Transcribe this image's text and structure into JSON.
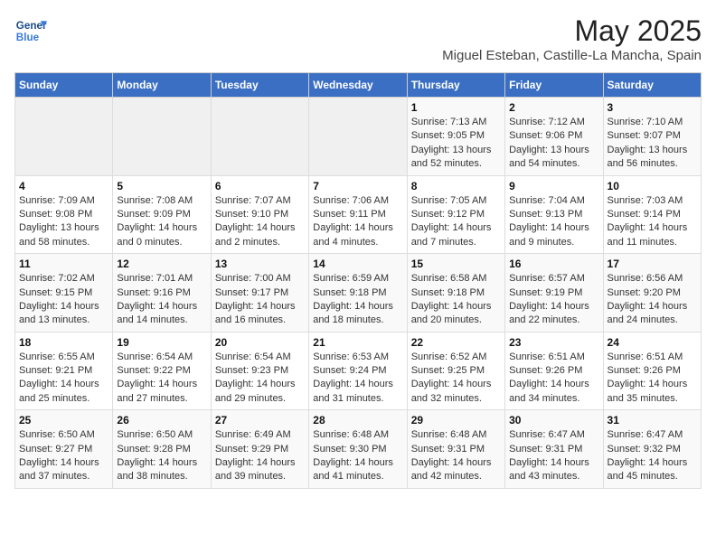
{
  "logo": {
    "line1": "General",
    "line2": "Blue"
  },
  "title": "May 2025",
  "subtitle": "Miguel Esteban, Castille-La Mancha, Spain",
  "headers": [
    "Sunday",
    "Monday",
    "Tuesday",
    "Wednesday",
    "Thursday",
    "Friday",
    "Saturday"
  ],
  "weeks": [
    [
      {
        "day": "",
        "info": ""
      },
      {
        "day": "",
        "info": ""
      },
      {
        "day": "",
        "info": ""
      },
      {
        "day": "",
        "info": ""
      },
      {
        "day": "1",
        "info": "Sunrise: 7:13 AM\nSunset: 9:05 PM\nDaylight: 13 hours\nand 52 minutes."
      },
      {
        "day": "2",
        "info": "Sunrise: 7:12 AM\nSunset: 9:06 PM\nDaylight: 13 hours\nand 54 minutes."
      },
      {
        "day": "3",
        "info": "Sunrise: 7:10 AM\nSunset: 9:07 PM\nDaylight: 13 hours\nand 56 minutes."
      }
    ],
    [
      {
        "day": "4",
        "info": "Sunrise: 7:09 AM\nSunset: 9:08 PM\nDaylight: 13 hours\nand 58 minutes."
      },
      {
        "day": "5",
        "info": "Sunrise: 7:08 AM\nSunset: 9:09 PM\nDaylight: 14 hours\nand 0 minutes."
      },
      {
        "day": "6",
        "info": "Sunrise: 7:07 AM\nSunset: 9:10 PM\nDaylight: 14 hours\nand 2 minutes."
      },
      {
        "day": "7",
        "info": "Sunrise: 7:06 AM\nSunset: 9:11 PM\nDaylight: 14 hours\nand 4 minutes."
      },
      {
        "day": "8",
        "info": "Sunrise: 7:05 AM\nSunset: 9:12 PM\nDaylight: 14 hours\nand 7 minutes."
      },
      {
        "day": "9",
        "info": "Sunrise: 7:04 AM\nSunset: 9:13 PM\nDaylight: 14 hours\nand 9 minutes."
      },
      {
        "day": "10",
        "info": "Sunrise: 7:03 AM\nSunset: 9:14 PM\nDaylight: 14 hours\nand 11 minutes."
      }
    ],
    [
      {
        "day": "11",
        "info": "Sunrise: 7:02 AM\nSunset: 9:15 PM\nDaylight: 14 hours\nand 13 minutes."
      },
      {
        "day": "12",
        "info": "Sunrise: 7:01 AM\nSunset: 9:16 PM\nDaylight: 14 hours\nand 14 minutes."
      },
      {
        "day": "13",
        "info": "Sunrise: 7:00 AM\nSunset: 9:17 PM\nDaylight: 14 hours\nand 16 minutes."
      },
      {
        "day": "14",
        "info": "Sunrise: 6:59 AM\nSunset: 9:18 PM\nDaylight: 14 hours\nand 18 minutes."
      },
      {
        "day": "15",
        "info": "Sunrise: 6:58 AM\nSunset: 9:18 PM\nDaylight: 14 hours\nand 20 minutes."
      },
      {
        "day": "16",
        "info": "Sunrise: 6:57 AM\nSunset: 9:19 PM\nDaylight: 14 hours\nand 22 minutes."
      },
      {
        "day": "17",
        "info": "Sunrise: 6:56 AM\nSunset: 9:20 PM\nDaylight: 14 hours\nand 24 minutes."
      }
    ],
    [
      {
        "day": "18",
        "info": "Sunrise: 6:55 AM\nSunset: 9:21 PM\nDaylight: 14 hours\nand 25 minutes."
      },
      {
        "day": "19",
        "info": "Sunrise: 6:54 AM\nSunset: 9:22 PM\nDaylight: 14 hours\nand 27 minutes."
      },
      {
        "day": "20",
        "info": "Sunrise: 6:54 AM\nSunset: 9:23 PM\nDaylight: 14 hours\nand 29 minutes."
      },
      {
        "day": "21",
        "info": "Sunrise: 6:53 AM\nSunset: 9:24 PM\nDaylight: 14 hours\nand 31 minutes."
      },
      {
        "day": "22",
        "info": "Sunrise: 6:52 AM\nSunset: 9:25 PM\nDaylight: 14 hours\nand 32 minutes."
      },
      {
        "day": "23",
        "info": "Sunrise: 6:51 AM\nSunset: 9:26 PM\nDaylight: 14 hours\nand 34 minutes."
      },
      {
        "day": "24",
        "info": "Sunrise: 6:51 AM\nSunset: 9:26 PM\nDaylight: 14 hours\nand 35 minutes."
      }
    ],
    [
      {
        "day": "25",
        "info": "Sunrise: 6:50 AM\nSunset: 9:27 PM\nDaylight: 14 hours\nand 37 minutes."
      },
      {
        "day": "26",
        "info": "Sunrise: 6:50 AM\nSunset: 9:28 PM\nDaylight: 14 hours\nand 38 minutes."
      },
      {
        "day": "27",
        "info": "Sunrise: 6:49 AM\nSunset: 9:29 PM\nDaylight: 14 hours\nand 39 minutes."
      },
      {
        "day": "28",
        "info": "Sunrise: 6:48 AM\nSunset: 9:30 PM\nDaylight: 14 hours\nand 41 minutes."
      },
      {
        "day": "29",
        "info": "Sunrise: 6:48 AM\nSunset: 9:31 PM\nDaylight: 14 hours\nand 42 minutes."
      },
      {
        "day": "30",
        "info": "Sunrise: 6:47 AM\nSunset: 9:31 PM\nDaylight: 14 hours\nand 43 minutes."
      },
      {
        "day": "31",
        "info": "Sunrise: 6:47 AM\nSunset: 9:32 PM\nDaylight: 14 hours\nand 45 minutes."
      }
    ]
  ]
}
